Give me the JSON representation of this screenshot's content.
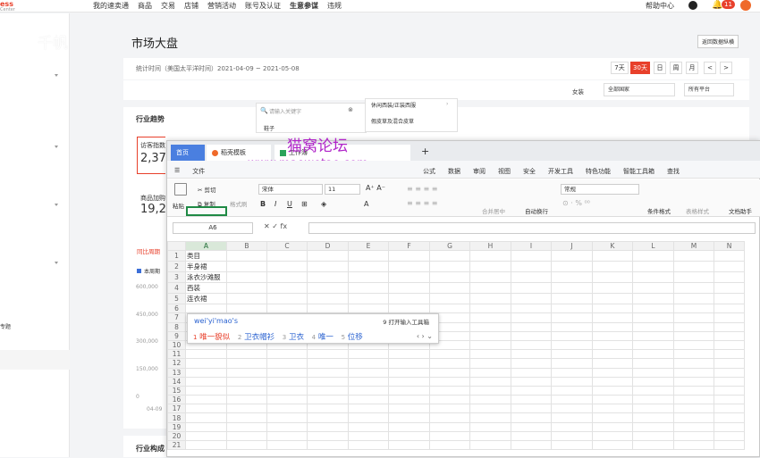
{
  "topbar": {
    "logo": "ess",
    "logo_sub": "Center",
    "nav": [
      "我的速卖通",
      "商品",
      "交易",
      "店铺",
      "营销活动",
      "账号及认证",
      "生意参谋",
      "违规"
    ],
    "nav_active": "生意参谋",
    "help": "帮助中心",
    "badge": "11"
  },
  "leftbar": {
    "special_label": "专题"
  },
  "watermark_top": "千帆",
  "page": {
    "title": "市场大盘",
    "data_link": "返回数据纵横",
    "date_label": "统计时间（美国太平洋时间）2021-04-09 ~ 2021-05-08",
    "date_buttons": [
      "7天",
      "30天",
      "日",
      "周",
      "月",
      "<",
      ">"
    ],
    "date_active": "30天",
    "filters": {
      "category": "女装",
      "country": "全部国家",
      "platform": "所有平台"
    }
  },
  "search_dropdown": {
    "placeholder": "请输入关键字",
    "item": "鞋子"
  },
  "category_dropdown": {
    "items": [
      "休闲西装/正装西服",
      "假皮草及混合皮草"
    ]
  },
  "trend": {
    "title": "行业趋势",
    "metric1_label": "访客指数",
    "metric1_value": "2,37",
    "metric2_label": "商品加购",
    "metric2_value": "19,2",
    "compare_label": "同比周期",
    "legend": "本周期",
    "yticks": [
      "600,000",
      "450,000",
      "300,000",
      "150,000",
      "0"
    ],
    "xtick": "04-09"
  },
  "struct_title": "行业构成",
  "wps": {
    "tab_home": "首页",
    "tab_draft": "稻壳模板",
    "tab_sheet": "工作簿",
    "tab_add": "+",
    "watermark_cn": "猫窝论坛",
    "watermark_url": "www.maowotao.com",
    "menu_file": "文件",
    "menus": [
      "公式",
      "数据",
      "审阅",
      "视图",
      "安全",
      "开发工具",
      "特色功能",
      "智能工具箱",
      "查找"
    ],
    "ribbon": {
      "cut": "剪切",
      "copy": "复制",
      "paste": "粘贴",
      "fmt_painter": "格式刷",
      "font": "宋体",
      "size": "11",
      "numfmt": "常规",
      "merge": "合并居中",
      "wrap": "自动换行",
      "cond": "条件格式",
      "table_style": "表格样式",
      "helper": "文档助手"
    },
    "name_box": "A6",
    "fx": "fx",
    "columns": [
      "A",
      "B",
      "C",
      "D",
      "E",
      "F",
      "G",
      "H",
      "I",
      "J",
      "K",
      "L",
      "M",
      "N"
    ],
    "rows": [
      "1",
      "2",
      "3",
      "4",
      "5",
      "6",
      "7",
      "8",
      "9",
      "10",
      "11",
      "12",
      "13",
      "14",
      "15",
      "16",
      "17",
      "18",
      "19",
      "20",
      "21"
    ],
    "cells": [
      "类目",
      "半身裙",
      "泳衣沙滩服",
      "西装",
      "连衣裙"
    ],
    "ime": {
      "input": "wei'yi'mao's",
      "tip": "9 打开输入工具箱",
      "candidates": [
        "唯一貌似",
        "卫衣帽衫",
        "卫衣",
        "唯一",
        "位移"
      ]
    }
  }
}
